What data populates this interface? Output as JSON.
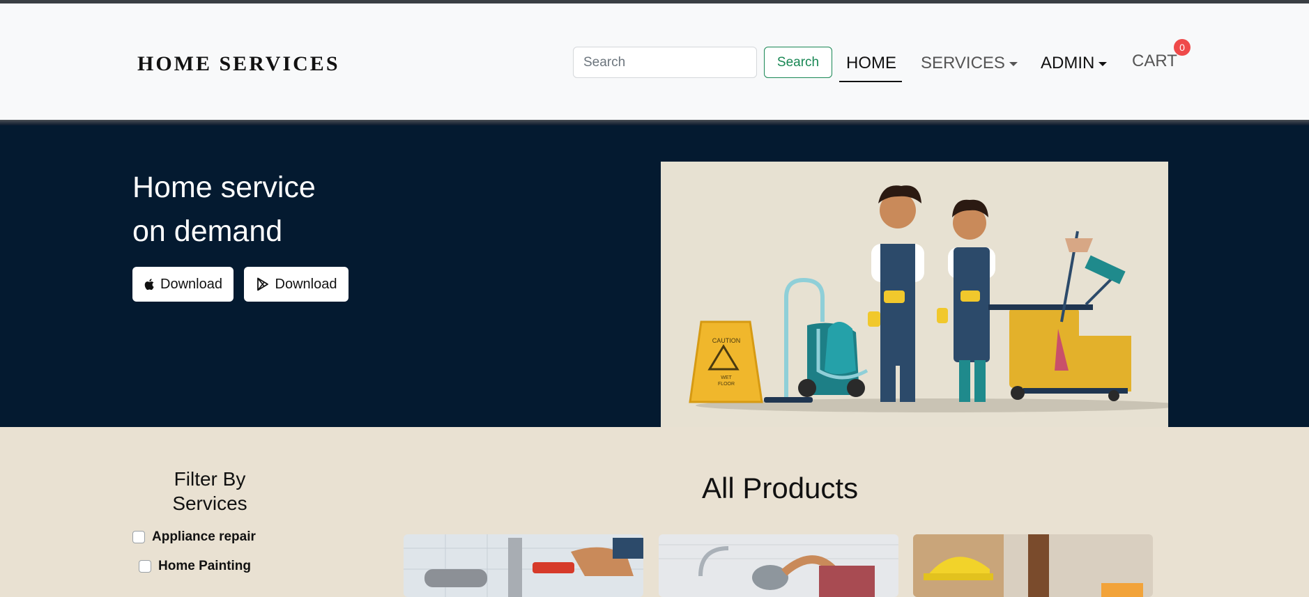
{
  "brand": "HOME SERVICES",
  "search": {
    "placeholder": "Search",
    "button_label": "Search"
  },
  "nav": {
    "home": "HOME",
    "services": "SERVICES",
    "admin": "ADMIN",
    "cart": "CART",
    "cart_count": "0"
  },
  "hero": {
    "title_line1": "Home service",
    "title_line2": "on demand",
    "download_apple_label": "Download",
    "download_play_label": "Download",
    "sign_text_caution": "CAUTION",
    "sign_text_wet": "WET",
    "sign_text_floor": "FLOOR"
  },
  "filter": {
    "title_line1": "Filter By",
    "title_line2": "Services",
    "options": [
      "Appliance repair",
      "Home Painting"
    ]
  },
  "products": {
    "title": "All Products"
  },
  "colors": {
    "navbar_bg": "#f8f9fa",
    "hero_bg": "#041a30",
    "page_bg": "#e9e1d2",
    "success": "#198754",
    "badge": "#ef4a4a"
  }
}
